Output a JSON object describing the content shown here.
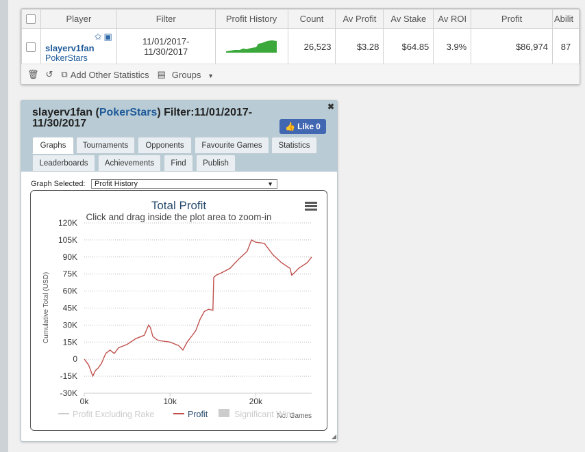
{
  "stats": {
    "columns": [
      "Player",
      "Filter",
      "Profit History",
      "Count",
      "Av Profit",
      "Av Stake",
      "Av ROI",
      "Profit",
      "Abilit"
    ],
    "row": {
      "player": "slayerv1fan",
      "site": "PokerStars",
      "filter": "11/01/2017-11/30/2017",
      "count": "26,523",
      "av_profit": "$3.28",
      "av_stake": "$64.85",
      "av_roi": "3.9%",
      "profit": "$86,974",
      "ability": "87"
    },
    "footer": {
      "add_stats": "Add Other Statistics",
      "groups": "Groups"
    }
  },
  "panel": {
    "player": "slayerv1fan",
    "site": "PokerStars",
    "filter_label": "Filter:",
    "filter_value": "11/01/2017-11/30/2017",
    "like_label": "Like",
    "like_count": "0",
    "tabs_row1": [
      "Graphs",
      "Tournaments",
      "Opponents",
      "Favourite Games",
      "Statistics"
    ],
    "tabs_row2": [
      "Leaderboards",
      "Achievements",
      "Find",
      "Publish"
    ],
    "active_tab": "Graphs",
    "graph_selected_label": "Graph Selected:",
    "graph_selected_value": "Profit History"
  },
  "chart_data": {
    "type": "line",
    "title": "Total Profit",
    "subtitle": "Click and drag inside the plot area to zoom-in",
    "xlabel": "No. Games",
    "ylabel": "Cumulative Total (USD)",
    "xlim": [
      0,
      26523
    ],
    "ylim": [
      -30000,
      120000
    ],
    "x_ticks": [
      "0k",
      "10k",
      "20k"
    ],
    "y_ticks": [
      "-30K",
      "-15K",
      "0",
      "15K",
      "30K",
      "45K",
      "60K",
      "75K",
      "90K",
      "105K",
      "120K"
    ],
    "grid": true,
    "legend": [
      "Profit Excluding Rake",
      "Profit",
      "Significant Wins"
    ],
    "legend_position": "bottom",
    "series": [
      {
        "name": "Profit",
        "color": "#c0504d",
        "x": [
          0,
          500,
          1000,
          1300,
          1600,
          2000,
          2500,
          3000,
          3500,
          4000,
          5000,
          6000,
          7000,
          7500,
          7700,
          8000,
          8500,
          9000,
          10000,
          11000,
          11500,
          12000,
          12500,
          13000,
          13500,
          14000,
          14500,
          15000,
          15100,
          15400,
          16000,
          17000,
          18000,
          19000,
          19500,
          20000,
          21000,
          22000,
          23000,
          24000,
          24200,
          24500,
          25000,
          26000,
          26523
        ],
        "y": [
          0,
          -5000,
          -15000,
          -10000,
          -8000,
          -4000,
          5000,
          8000,
          5000,
          10000,
          13000,
          18000,
          21000,
          30000,
          28000,
          20000,
          17000,
          16000,
          15000,
          12000,
          8000,
          15000,
          20000,
          25000,
          35000,
          42000,
          44000,
          43000,
          72000,
          74000,
          76000,
          80000,
          88000,
          95000,
          105000,
          103000,
          102000,
          92000,
          85000,
          80000,
          74000,
          76000,
          80000,
          85000,
          90000
        ]
      }
    ]
  }
}
